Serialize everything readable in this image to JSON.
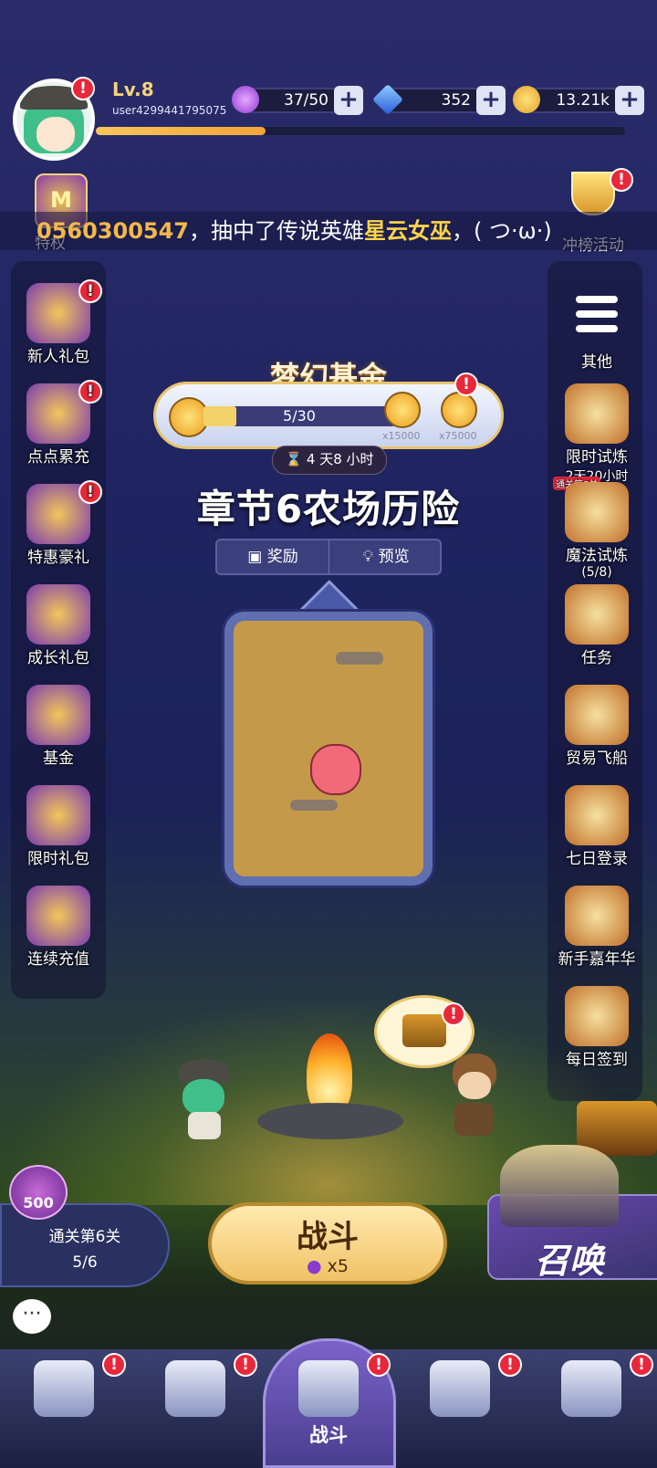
{
  "player": {
    "level": "Lv.8",
    "user_id": "user4299441795075",
    "xp_fraction": 0.32
  },
  "resources": {
    "energy": "37/50",
    "gems": "352",
    "coins": "13.21k"
  },
  "ticker": {
    "prefix": "0560300547",
    "mid": "，抽中了传说英雄",
    "hero": "星云女巫",
    "suffix": "，( つ·ω·)"
  },
  "top_left": {
    "label": "特权",
    "icon": "m-coin-icon"
  },
  "top_right": {
    "label": "冲榜活动",
    "icon": "trophy-icon"
  },
  "left_menu": [
    {
      "label": "新人礼包",
      "icon": "vampire-girl-icon",
      "badge": "!"
    },
    {
      "label": "点点累充",
      "icon": "gift-box-icon",
      "badge": "!"
    },
    {
      "label": "特惠豪礼",
      "icon": "gold-pouch-icon",
      "badge": "!"
    },
    {
      "label": "成长礼包",
      "icon": "card-chest-icon",
      "badge": ""
    },
    {
      "label": "基金",
      "icon": "winged-shield-icon",
      "badge": ""
    },
    {
      "label": "限时礼包",
      "icon": "gem-chest-icon",
      "badge": ""
    },
    {
      "label": "连续充值",
      "icon": "blue-chest-icon",
      "badge": ""
    }
  ],
  "right_menu": [
    {
      "label": "其他",
      "icon": "hamburger-menu-icon"
    },
    {
      "label": "限时试炼",
      "sub": "2天20小时",
      "icon": "tv-gift-icon"
    },
    {
      "label": "魔法试炼",
      "tag": "通关第8关",
      "sub": "(5/8)",
      "icon": "heroes-portrait-icon"
    },
    {
      "label": "任务",
      "icon": "scroll-quill-icon"
    },
    {
      "label": "贸易飞船",
      "icon": "airship-icon"
    },
    {
      "label": "七日登录",
      "icon": "calendar-icon"
    },
    {
      "label": "新手嘉年华",
      "icon": "carnival-gift-icon"
    },
    {
      "label": "每日签到",
      "icon": "cards-icon"
    }
  ],
  "fund": {
    "title": "梦幻基金",
    "progress": "5/30",
    "progress_fraction": 0.17,
    "reward_a": "x15000",
    "reward_b": "x75000",
    "timer": "4 天8 小时"
  },
  "chapter": {
    "title": "章节6农场历险",
    "tab_rewards": "奖励",
    "tab_preview": "预览"
  },
  "stage_progress": {
    "reward": "500",
    "label": "通关第6关",
    "count": "5/6"
  },
  "battle": {
    "label": "战斗",
    "cost": "x5"
  },
  "summon": {
    "label": "召唤"
  },
  "nav": [
    {
      "icon": "shop-icon",
      "label": ""
    },
    {
      "icon": "helmet-icon",
      "label": ""
    },
    {
      "icon": "battle-crest-icon",
      "label": "战斗"
    },
    {
      "icon": "castle-icon",
      "label": ""
    },
    {
      "icon": "map-icon",
      "label": ""
    }
  ],
  "colors": {
    "badge": "#e8283a",
    "accent_gold": "#f4b84a",
    "nav_active": "#7a63c8"
  }
}
